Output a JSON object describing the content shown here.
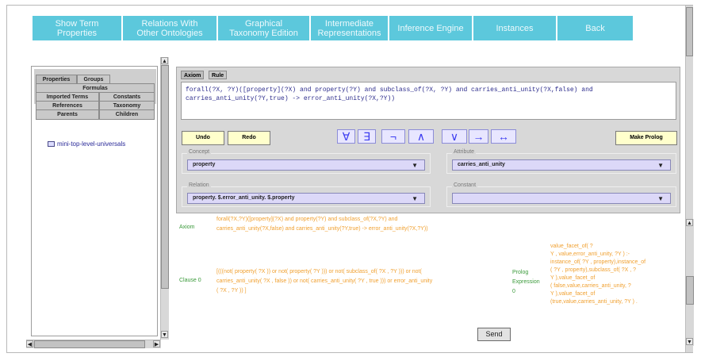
{
  "nav": {
    "items": [
      {
        "line1": "Show Term",
        "line2": "Properties"
      },
      {
        "line1": "Relations With",
        "line2": "Other Ontologies"
      },
      {
        "line1": "Graphical",
        "line2": "Taxonomy Edition"
      },
      {
        "line1": "Intermediate",
        "line2": "Representations"
      },
      {
        "line1": "Inference Engine",
        "line2": ""
      },
      {
        "line1": "Instances",
        "line2": ""
      },
      {
        "line1": "Back",
        "line2": ""
      }
    ]
  },
  "left": {
    "tabs": {
      "properties": "Properties",
      "groups": "Groups",
      "formulas": "Formulas",
      "imported_terms": "Imported Terms",
      "constants": "Constants",
      "references": "References",
      "taxonomy": "Taxonomy",
      "parents": "Parents",
      "children": "Children"
    },
    "tree_item": "mini-top-level-universals"
  },
  "right": {
    "tabs": {
      "axiom": "Axiom",
      "rule": "Rule"
    },
    "formula_line1": "forall(?X, ?Y)([property](?X) and property(?Y) and subclass_of(?X, ?Y) and carries_anti_unity(?X,false) and",
    "formula_line2": "carries_anti_unity(?Y,true) -> error_anti_unity(?X,?Y))",
    "undo": "Undo",
    "redo": "Redo",
    "symbols": [
      "∀",
      "∃",
      "¬",
      "∧",
      "∨",
      "→",
      "↔"
    ],
    "make_prolog": "Make Prolog",
    "concept": {
      "label": "Concept",
      "value": "property"
    },
    "attribute": {
      "label": "Attribute",
      "value": "carries_anti_unity"
    },
    "relation": {
      "label": "Relation",
      "value": "property. $.error_anti_unity. $.property"
    },
    "constant": {
      "label": "Constant",
      "value": ""
    }
  },
  "bottom": {
    "axiom_label": "Axiom",
    "axiom_line1": "forall(?X,?Y)([property](?X) and property(?Y) and subclass_of(?X,?Y) and",
    "axiom_line2": "carries_anti_unity(?X,false) and carries_anti_unity(?Y,true) -> error_anti_unity(?X,?Y))",
    "clause_label": "Clause 0",
    "clause_line1": "[(((not( property( ?X )) or not( property( ?Y ))) or not( subclass_of( ?X , ?Y ))) or not(",
    "clause_line2": "carries_anti_unity( ?X , false )) or not( carries_anti_unity( ?Y , true ))) or error_anti_unity",
    "clause_line3": "( ?X , ?Y )) ]",
    "prolog_label1": "Prolog",
    "prolog_label2": "Expression",
    "prolog_label3": "0",
    "prolog_lines": [
      "value_facet_of( ?",
      "Y , value,error_anti_unity, ?Y ) :-",
      "instance_of( ?Y , property),instance_of",
      "( ?Y , property),subclass_of( ?X , ?",
      "Y ),value_facet_of",
      "( false,value,carries_anti_unity, ?",
      "Y ),value_facet_of",
      "(true,value,carries_anti_unity, ?Y ) ."
    ],
    "send": "Send"
  }
}
